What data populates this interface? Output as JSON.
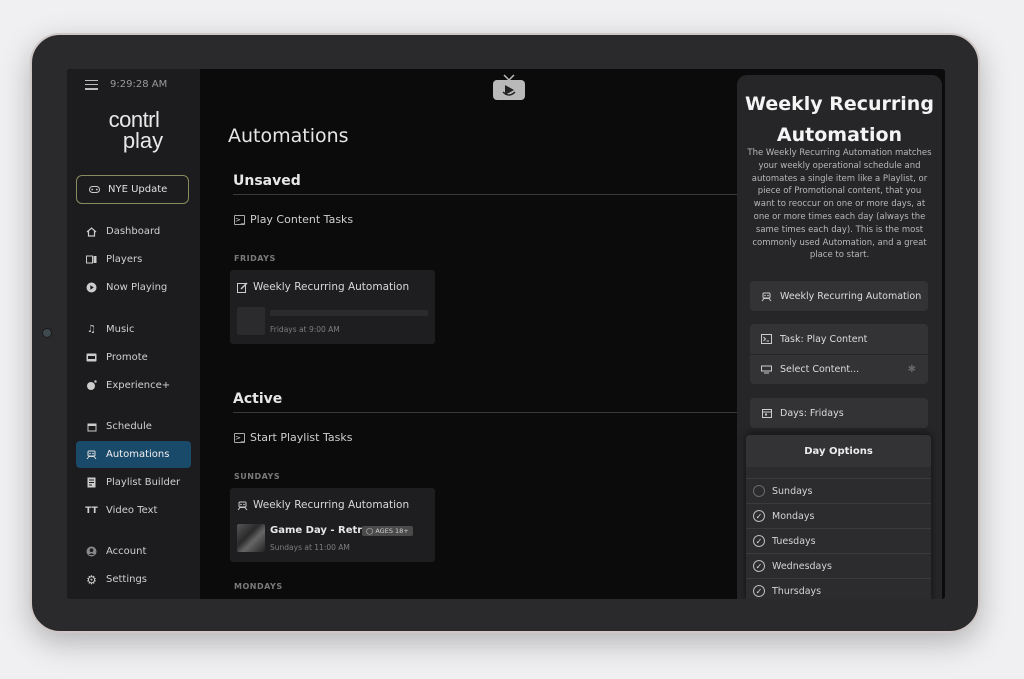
{
  "sidebar": {
    "time": "9:29:28 AM",
    "logo_line1": "contrl",
    "logo_line2": "play",
    "update_button": "NYE Update",
    "group1": [
      {
        "label": "Dashboard",
        "icon": "home-icon"
      },
      {
        "label": "Players",
        "icon": "players-icon"
      },
      {
        "label": "Now Playing",
        "icon": "play-circle-icon"
      }
    ],
    "group2": [
      {
        "label": "Music",
        "icon": "music-note-icon"
      },
      {
        "label": "Promote",
        "icon": "ad-icon"
      },
      {
        "label": "Experience+",
        "icon": "experience-icon"
      }
    ],
    "group3": [
      {
        "label": "Schedule",
        "icon": "calendar-icon"
      },
      {
        "label": "Automations",
        "icon": "robot-icon",
        "active": true
      },
      {
        "label": "Playlist Builder",
        "icon": "playlist-icon"
      },
      {
        "label": "Video Text",
        "icon": "text-icon"
      }
    ],
    "group4": [
      {
        "label": "Account",
        "icon": "account-icon"
      },
      {
        "label": "Settings",
        "icon": "gear-icon"
      }
    ]
  },
  "main": {
    "title": "Automations",
    "unsaved": {
      "heading": "Unsaved",
      "task_label": "Play Content Tasks",
      "day": "FRIDAYS",
      "card_title": "Weekly Recurring Automation",
      "schedule": "Fridays at 9:00 AM"
    },
    "active": {
      "heading": "Active",
      "task_label": "Start Playlist Tasks",
      "day": "SUNDAYS",
      "card_title": "Weekly Recurring Automation",
      "item_name": "Game Day - Retro",
      "badge": "AGES 18+",
      "schedule": "Sundays at 11:00 AM",
      "next_day": "MONDAYS"
    }
  },
  "panel": {
    "title_line1": "Weekly Recurring",
    "title_line2": "Automation",
    "description": "The Weekly Recurring Automation matches your weekly operational schedule and automates a single item like a Playlist, or piece of Promotional content, that you want to reoccur on one or more days, at one or more times each day (always the same times each day). This is the most commonly used Automation, and a great place to start.",
    "automation_type": "Weekly Recurring Automation",
    "task": "Task: Play Content",
    "select_content": "Select Content...",
    "days": "Days: Fridays",
    "dropdown": {
      "heading": "Day Options",
      "options": [
        {
          "label": "Sundays",
          "checked": false
        },
        {
          "label": "Mondays",
          "checked": true
        },
        {
          "label": "Tuesdays",
          "checked": true
        },
        {
          "label": "Wednesdays",
          "checked": true
        },
        {
          "label": "Thursdays",
          "checked": true
        }
      ]
    }
  }
}
